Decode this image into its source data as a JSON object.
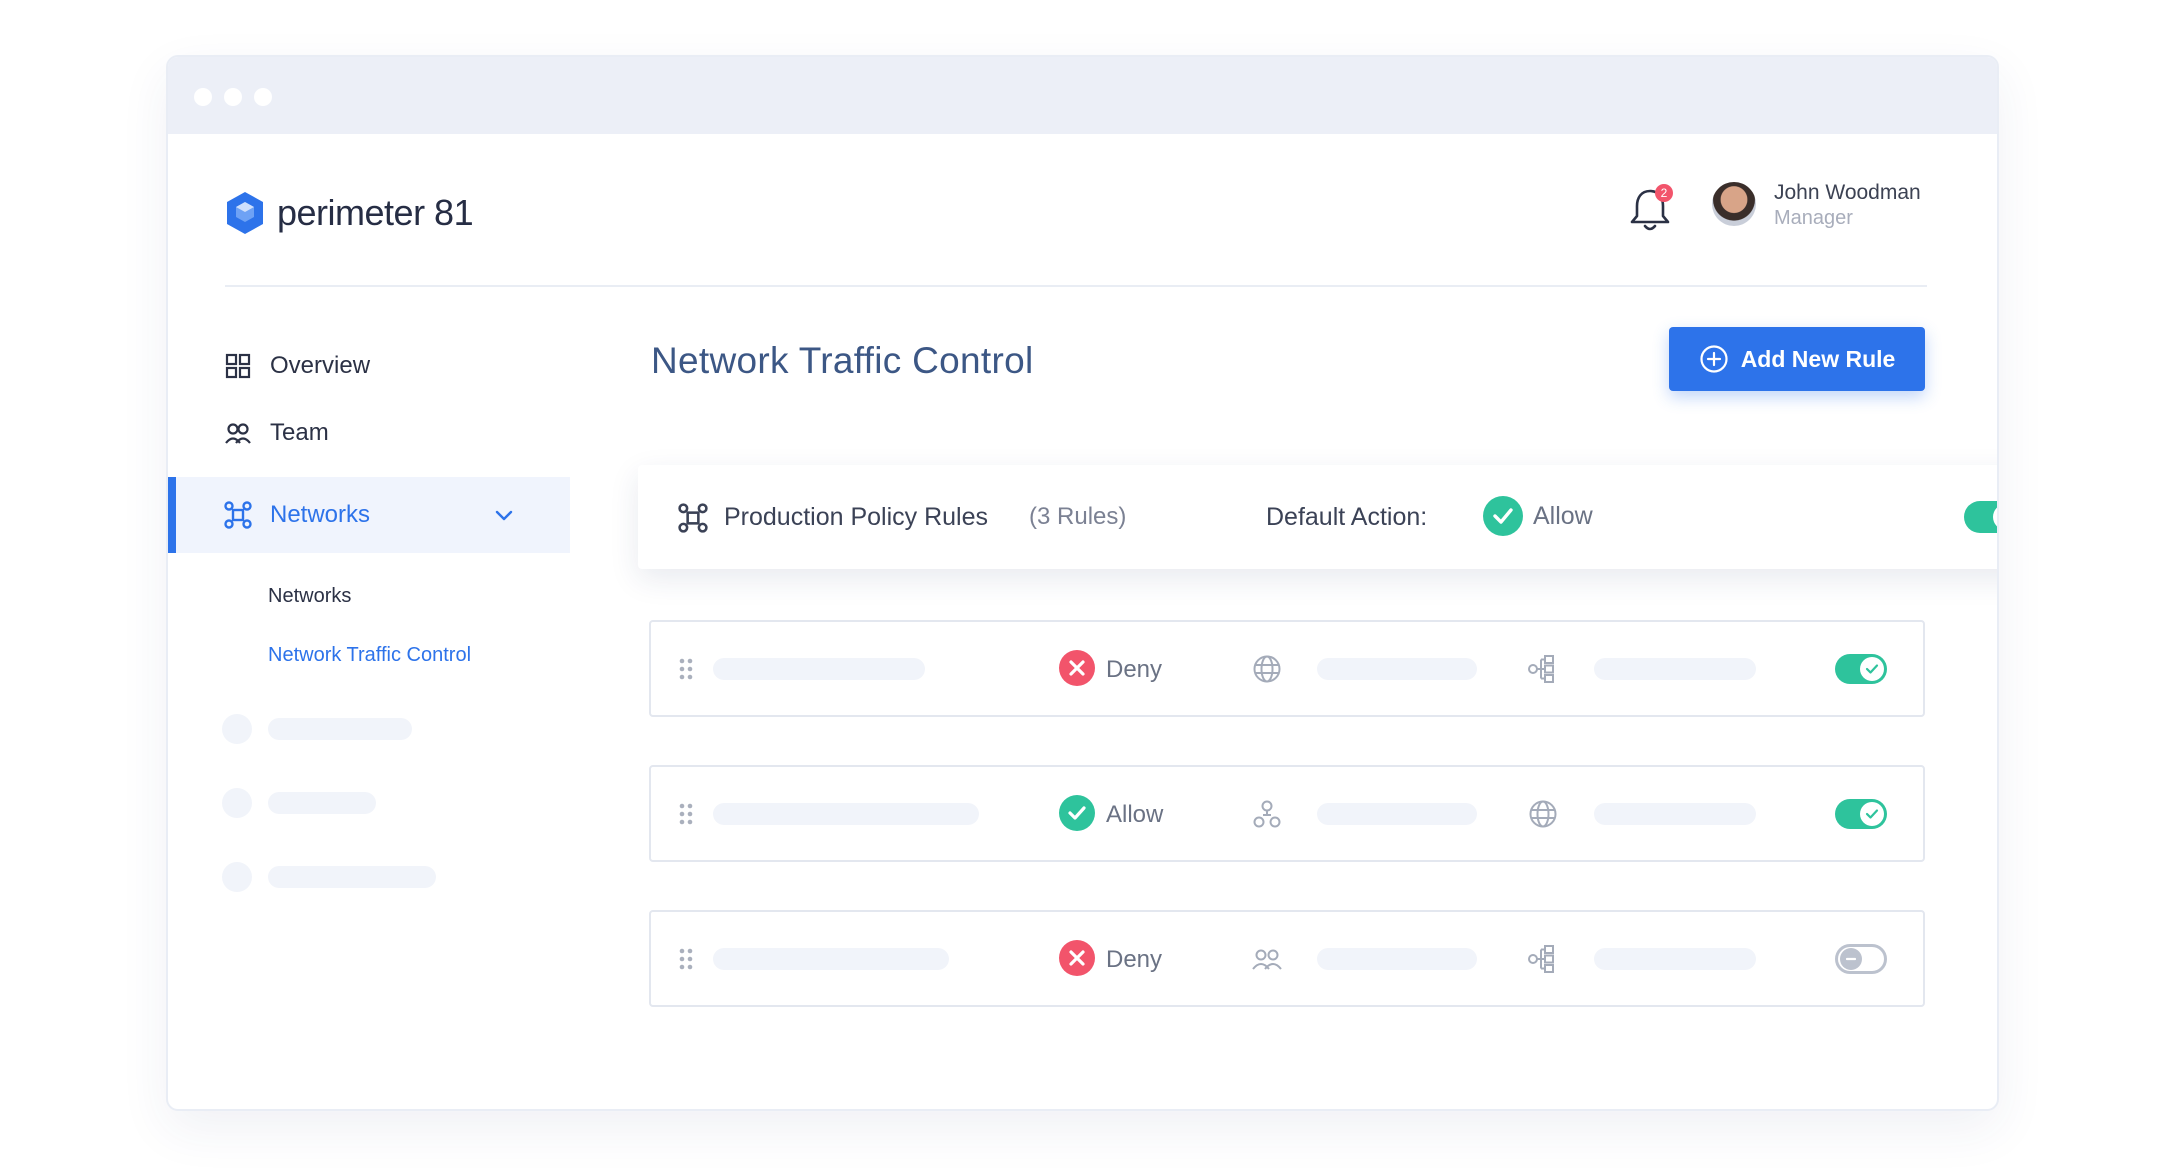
{
  "window": {
    "controls": [
      "dot",
      "dot",
      "dot"
    ]
  },
  "brand": {
    "name": "perimeter 81",
    "color": "#2d73ea"
  },
  "header": {
    "notifications": {
      "icon": "bell-icon",
      "count": "2"
    },
    "user": {
      "name": "John Woodman",
      "role": "Manager"
    }
  },
  "sidebar": {
    "items": [
      {
        "label": "Overview",
        "icon": "grid-icon"
      },
      {
        "label": "Team",
        "icon": "team-icon"
      },
      {
        "label": "Networks",
        "icon": "network-icon",
        "active": true,
        "expanded": true
      }
    ],
    "subitems": [
      {
        "label": "Networks",
        "active": false
      },
      {
        "label": "Network Traffic Control",
        "active": true
      }
    ]
  },
  "main": {
    "title": "Network Traffic Control",
    "add_button": {
      "label": "Add New Rule",
      "icon": "plus-circle-icon"
    },
    "policy": {
      "name": "Production Policy Rules",
      "count": "(3 Rules)",
      "default_label": "Default Action:",
      "default_value": "Allow",
      "enabled": true
    },
    "rules": [
      {
        "action": "Deny",
        "source_icon": "globe-icon",
        "dest_icon": "nodes-icon",
        "enabled": true
      },
      {
        "action": "Allow",
        "source_icon": "user-group-icon",
        "dest_icon": "globe-icon",
        "enabled": true
      },
      {
        "action": "Deny",
        "source_icon": "team-icon",
        "dest_icon": "nodes-icon",
        "enabled": false
      }
    ]
  },
  "colors": {
    "accent": "#2d73ea",
    "allow": "#2ec39c",
    "deny": "#f2546b"
  }
}
